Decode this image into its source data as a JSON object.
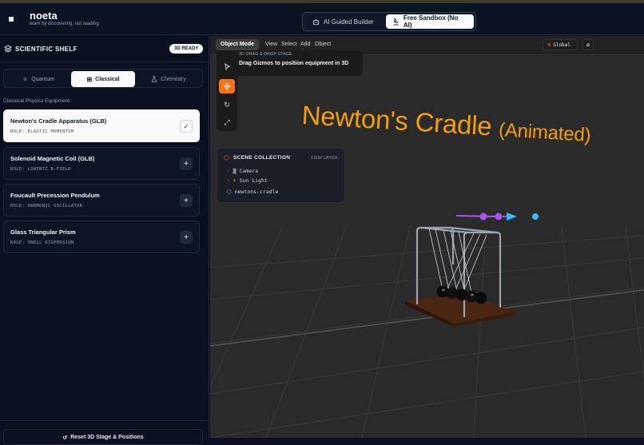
{
  "header": {
    "brand": "noeta",
    "tagline": "learn by discovering, not reading",
    "modes": [
      {
        "label": "AI Guided Builder",
        "icon": "robot-icon",
        "active": false
      },
      {
        "label": "Free Sandbox (No AI)",
        "icon": "microscope-icon",
        "active": true
      }
    ]
  },
  "sidebar": {
    "title": "SCIENTIFIC SHELF",
    "status_badge": "3D READY",
    "tabs": [
      {
        "label": "Quantum",
        "icon": "atom-icon",
        "active": false
      },
      {
        "label": "Classical",
        "icon": "grid-icon",
        "active": true
      },
      {
        "label": "Chemistry",
        "icon": "flask-icon",
        "active": false
      }
    ],
    "section_heading": "Classical Physics Equipment:",
    "equipment": [
      {
        "name": "Newton's Cradle Apparatus (GLB)",
        "role": "ROLE: ELASTIC MOMENTUM",
        "added": true,
        "action_icon": "check-icon"
      },
      {
        "name": "Solenoid Magnetic Coil (GLB)",
        "role": "ROLE: LORENTZ B-FIELD",
        "added": false,
        "action_icon": "plus-icon"
      },
      {
        "name": "Foucault Precession Pendulum",
        "role": "ROLE: HARMONIC OSCILLATOR",
        "added": false,
        "action_icon": "plus-icon"
      },
      {
        "name": "Glass Triangular Prism",
        "role": "ROLE: SNELL DISPERSION",
        "added": false,
        "action_icon": "plus-icon"
      }
    ],
    "reset_label": "Reset 3D Stage & Positions"
  },
  "viewport": {
    "mode_label": "Object Mode",
    "menu": [
      "View",
      "Select",
      "Add",
      "Object"
    ],
    "transform_space": "Global",
    "tools": [
      "select-cursor-icon",
      "move-icon",
      "rotate-icon",
      "scale-icon"
    ],
    "active_tool": "move-icon",
    "hint_title": "3D DRAG & DROP STAGE",
    "hint_text": "Drag Gizmos to position equipment in 3D",
    "scene_collection": {
      "title": "SCENE COLLECTION",
      "view_layer": "VIEW LAYER",
      "items": [
        {
          "label": "Camera",
          "icon": "camera-icon"
        },
        {
          "label": "Sun Light",
          "icon": "sun-icon"
        },
        {
          "label": "newtons-cradle",
          "icon": "cube-icon"
        }
      ]
    },
    "object_label_main": "Newton's Cradle",
    "object_label_sub": "(Animated)",
    "colors": {
      "accent": "#f97316",
      "label": "#f59e0b",
      "gizmo_x": "#a855f7",
      "gizmo_y": "#38bdf8"
    }
  }
}
